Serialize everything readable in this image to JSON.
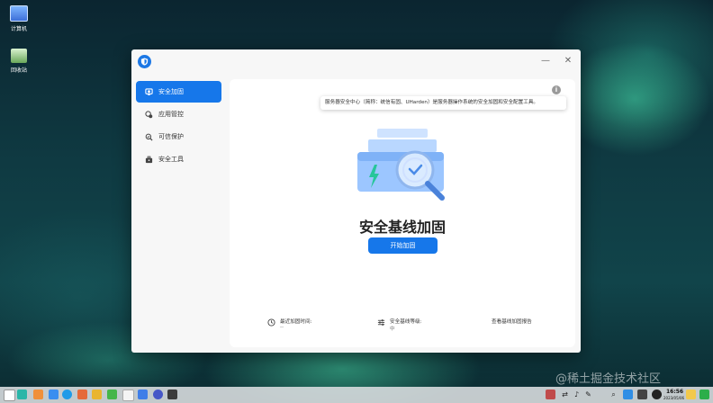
{
  "desktop": {
    "icons": [
      {
        "label": "计算机"
      },
      {
        "label": "回收站"
      }
    ]
  },
  "window": {
    "minimize_glyph": "—",
    "close_glyph": "✕",
    "sidebar": {
      "items": [
        {
          "label": "安全加固",
          "icon": "shield-monitor-icon",
          "active": true
        },
        {
          "label": "应用管控",
          "icon": "app-control-icon"
        },
        {
          "label": "可信保护",
          "icon": "trusted-search-icon"
        },
        {
          "label": "安全工具",
          "icon": "toolbox-icon"
        }
      ]
    },
    "content": {
      "info_glyph": "i",
      "tooltip": "服务器安全中心（简称：统信有固、UHarden）是服务器操作系统的安全加固和安全配置工具。",
      "headline": "安全基线加固",
      "start_button": "开始加固",
      "footer": {
        "last_time_label": "最近加固时间:",
        "last_time_value": "--",
        "level_label": "安全基线等级:",
        "level_value": "中",
        "report_link": "查看基线加固报告"
      }
    }
  },
  "taskbar": {
    "clock_time": "16:56",
    "clock_date": "2023/05/06"
  },
  "watermark": "@稀土掘金技术社区"
}
